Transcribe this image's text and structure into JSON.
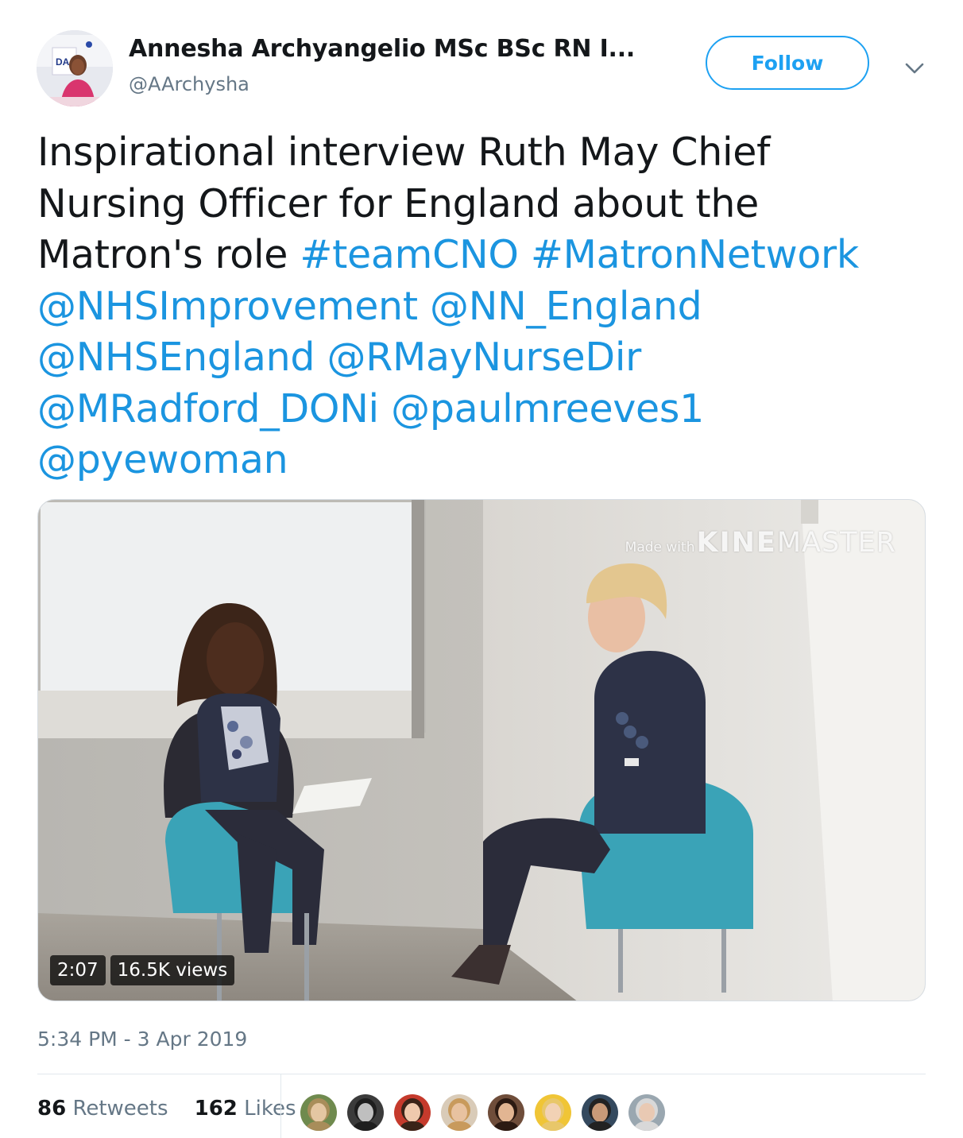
{
  "author": {
    "display_name": "Annesha Archyangelio MSc BSc RN I...",
    "handle": "@AArchysha",
    "avatar_icon": "profile-avatar",
    "avatar_banner_text": "DA"
  },
  "actions": {
    "follow_label": "Follow",
    "menu_icon": "chevron-down-icon"
  },
  "tweet": {
    "segments": [
      {
        "text": "Inspirational interview Ruth May Chief Nursing Officer for England about the Matron's role ",
        "type": "text"
      },
      {
        "text": "#teamCNO",
        "type": "link"
      },
      {
        "text": " ",
        "type": "text"
      },
      {
        "text": "#MatronNetwork",
        "type": "link"
      },
      {
        "text": " ",
        "type": "text"
      },
      {
        "text": "@NHSImprovement",
        "type": "link"
      },
      {
        "text": " ",
        "type": "text"
      },
      {
        "text": "@NN_England",
        "type": "link"
      },
      {
        "text": " ",
        "type": "text"
      },
      {
        "text": "@NHSEngland",
        "type": "link"
      },
      {
        "text": " ",
        "type": "text"
      },
      {
        "text": "@RMayNurseDir",
        "type": "link"
      },
      {
        "text": " ",
        "type": "text"
      },
      {
        "text": "@MRadford_DONi",
        "type": "link"
      },
      {
        "text": " ",
        "type": "text"
      },
      {
        "text": "@paulmreeves1",
        "type": "link"
      },
      {
        "text": " ",
        "type": "text"
      },
      {
        "text": "@pyewoman",
        "type": "link"
      }
    ]
  },
  "media": {
    "watermark_prefix": "Made with",
    "watermark_bold": "KINE",
    "watermark_rest": "MASTER",
    "duration": "2:07",
    "views": "16.5K views"
  },
  "meta": {
    "timestamp": "5:34 PM - 3 Apr 2019"
  },
  "stats": {
    "retweets_count": "86",
    "retweets_label": "Retweets",
    "likes_count": "162",
    "likes_label": "Likes"
  },
  "likers": [
    {
      "name": "liker-avatar-1",
      "bg": "#6f8a4e",
      "face": "#e4c6a2",
      "hair": "#a88d5a"
    },
    {
      "name": "liker-avatar-2",
      "bg": "#3b3b3b",
      "face": "#bfbfbf",
      "hair": "#1e1e1e"
    },
    {
      "name": "liker-avatar-3",
      "bg": "#c53a2c",
      "face": "#efc9ad",
      "hair": "#3a2318"
    },
    {
      "name": "liker-avatar-4",
      "bg": "#d9cbb8",
      "face": "#e8c2a0",
      "hair": "#c89a5c"
    },
    {
      "name": "liker-avatar-5",
      "bg": "#6f4d3a",
      "face": "#e2b592",
      "hair": "#2c1a12"
    },
    {
      "name": "liker-avatar-6",
      "bg": "#f0c536",
      "face": "#f2d2b5",
      "hair": "#e8c76a"
    },
    {
      "name": "liker-avatar-7",
      "bg": "#34495e",
      "face": "#c99a78",
      "hair": "#222222"
    },
    {
      "name": "liker-avatar-8",
      "bg": "#9aa7b0",
      "face": "#e9c9b3",
      "hair": "#d8d8d8"
    }
  ],
  "colors": {
    "link": "#1b95e0",
    "follow": "#1da1f2",
    "secondary_text": "#657786",
    "chair": "#3aa3b7"
  }
}
